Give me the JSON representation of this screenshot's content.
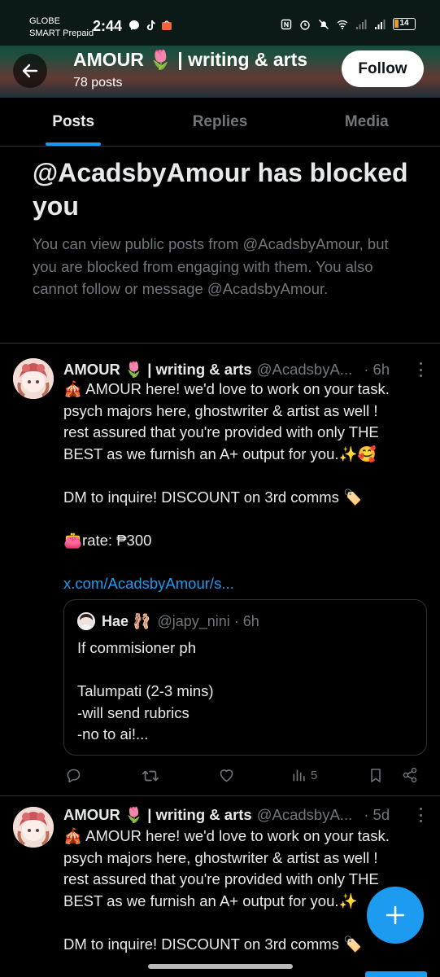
{
  "status_bar": {
    "carrier_line1": "GLOBE",
    "carrier_line2": "SMART Prepaid",
    "time": "2:44",
    "battery": "14"
  },
  "header": {
    "title": "AMOUR 🌷 | writing & arts",
    "post_count": "78 posts",
    "follow_label": "Follow"
  },
  "tabs": [
    {
      "label": "Posts",
      "active": true
    },
    {
      "label": "Replies",
      "active": false
    },
    {
      "label": "Media",
      "active": false
    }
  ],
  "blocked": {
    "title": "@AcadsbyAmour has blocked you",
    "body": "You can view public posts from @AcadsbyAmour, but you are blocked from engaging with them. You also cannot follow or message @AcadsbyAmour."
  },
  "posts": [
    {
      "name": "AMOUR 🌷 | writing & arts",
      "handle": "@AcadsbyA...",
      "time": "· 6h",
      "lines": [
        "🎪 AMOUR here! we'd love to work on your task.",
        "psych majors here, ghostwriter & artist as well !",
        "rest assured that you're provided with only THE",
        "BEST as we furnish an A+ output for you.✨🥰",
        "",
        "DM to inquire! DISCOUNT on 3rd comms 🏷️",
        "",
        "👛rate: ₱300",
        ""
      ],
      "link": "x.com/AcadsbyAmour/s...",
      "quote": {
        "name": "Hae 🩰",
        "handle": "@japy_nini · 6h",
        "lines": [
          "If commisioner ph",
          "",
          "Talumpati (2-3 mins)",
          "-will send rubrics",
          "-no to ai!..."
        ]
      },
      "views": "5"
    },
    {
      "name": "AMOUR 🌷 | writing & arts",
      "handle": "@AcadsbyA...",
      "time": "· 5d",
      "lines": [
        "🎪 AMOUR here! we'd love to work on your task.",
        "psych majors here, ghostwriter & artist as well !",
        "rest assured that you're provided with only THE",
        "BEST as we furnish an A+ output for you.✨",
        "",
        "DM to inquire! DISCOUNT on 3rd comms 🏷️"
      ]
    }
  ],
  "colors": {
    "accent": "#1d9bf0",
    "muted": "#71767b",
    "text": "#e7e9ea",
    "border": "#2f3336"
  }
}
